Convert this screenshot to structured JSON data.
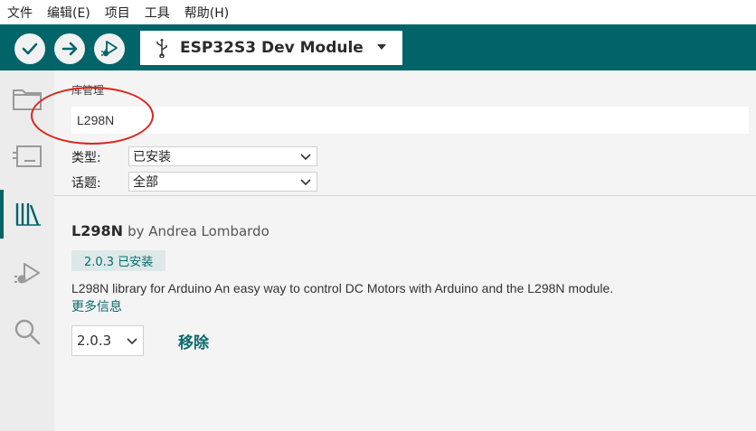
{
  "menu": [
    "文件",
    "编辑(E)",
    "项目",
    "工具",
    "帮助(H)"
  ],
  "toolbar": {
    "board_name": "ESP32S3 Dev Module",
    "verify_icon": "check-icon",
    "upload_icon": "arrow-right-icon",
    "debug_icon": "debug-icon"
  },
  "library_manager": {
    "title": "库管理",
    "search_value": "L298N",
    "type_label": "类型:",
    "type_value": "已安装",
    "topic_label": "话题:",
    "topic_value": "全部"
  },
  "library": {
    "name": "L298N",
    "by": "by Andrea Lombardo",
    "installed_badge": "2.0.3 已安装",
    "description": "L298N library for Arduino An easy way to control DC Motors with Arduino and the L298N module.",
    "more_info": "更多信息",
    "version": "2.0.3",
    "remove_label": "移除"
  },
  "colors": {
    "accent": "#006468",
    "link": "#0b6a6d",
    "annotation": "#d9261c"
  }
}
